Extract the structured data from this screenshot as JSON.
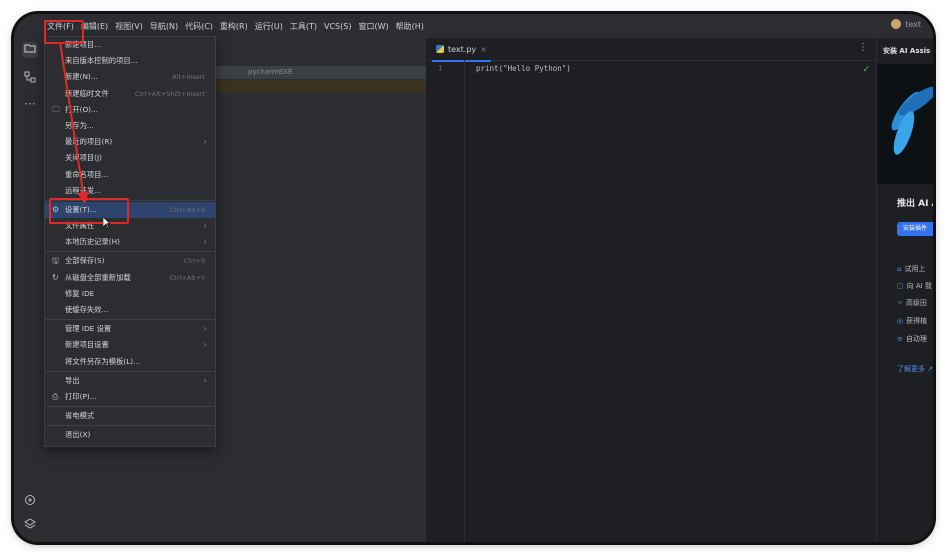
{
  "menubar": {
    "items": [
      "文件(F)",
      "编辑(E)",
      "视图(V)",
      "导航(N)",
      "代码(C)",
      "重构(R)",
      "运行(U)",
      "工具(T)",
      "VCS(S)",
      "窗口(W)",
      "帮助(H)"
    ],
    "account": "text"
  },
  "left_toolbar": {
    "icons": [
      "folder-icon",
      "structure-icon",
      "more-icon",
      "python-console-icon",
      "layers-icon"
    ]
  },
  "project_panel": {
    "row_text": "pycharmEXE"
  },
  "editor": {
    "tab_label": "text.py",
    "tab_close": "×",
    "line_number": "1",
    "code_line": "print(\"Hello Python\")",
    "menu_glyph": "⋮",
    "check_glyph": "✓"
  },
  "file_menu": {
    "items": [
      {
        "label": "新建项目...",
        "shortcut": "",
        "arrow": false,
        "icon": ""
      },
      {
        "label": "来自版本控制的项目...",
        "shortcut": "",
        "arrow": false,
        "icon": ""
      },
      {
        "label": "新建(N)...",
        "shortcut": "Alt+Insert",
        "arrow": false,
        "icon": ""
      },
      {
        "label": "新建临时文件",
        "shortcut": "Ctrl+Alt+Shift+Insert",
        "arrow": false,
        "icon": ""
      },
      {
        "label": "打开(O)...",
        "shortcut": "",
        "arrow": false,
        "icon": "🗀"
      },
      {
        "label": "另存为...",
        "shortcut": "",
        "arrow": false,
        "icon": ""
      },
      {
        "label": "最近的项目(R)",
        "shortcut": "",
        "arrow": true,
        "icon": ""
      },
      {
        "label": "关闭项目(J)",
        "shortcut": "",
        "arrow": false,
        "icon": ""
      },
      {
        "label": "重命名项目...",
        "shortcut": "",
        "arrow": false,
        "icon": ""
      },
      {
        "label": "远程开发...",
        "shortcut": "",
        "arrow": false,
        "icon": ""
      },
      {
        "sep": true
      },
      {
        "label": "设置(T)...",
        "shortcut": "Ctrl+Alt+S",
        "arrow": false,
        "icon": "⚙",
        "highlight": true
      },
      {
        "label": "文件属性",
        "shortcut": "",
        "arrow": true,
        "icon": ""
      },
      {
        "label": "本地历史记录(H)",
        "shortcut": "",
        "arrow": true,
        "icon": ""
      },
      {
        "sep": true
      },
      {
        "label": "全部保存(S)",
        "shortcut": "Ctrl+S",
        "arrow": false,
        "icon": "🖫"
      },
      {
        "label": "从磁盘全部重新加载",
        "shortcut": "Ctrl+Alt+Y",
        "arrow": false,
        "icon": "↻"
      },
      {
        "label": "修复 IDE",
        "shortcut": "",
        "arrow": false,
        "icon": ""
      },
      {
        "label": "使缓存失效...",
        "shortcut": "",
        "arrow": false,
        "icon": ""
      },
      {
        "sep": true
      },
      {
        "label": "管理 IDE 设置",
        "shortcut": "",
        "arrow": true,
        "icon": ""
      },
      {
        "label": "新建项目设置",
        "shortcut": "",
        "arrow": true,
        "icon": ""
      },
      {
        "label": "将文件另存为模板(L)...",
        "shortcut": "",
        "arrow": false,
        "icon": ""
      },
      {
        "sep": true
      },
      {
        "label": "导出",
        "shortcut": "",
        "arrow": true,
        "icon": ""
      },
      {
        "label": "打印(P)...",
        "shortcut": "",
        "arrow": false,
        "icon": "⎙"
      },
      {
        "sep": true
      },
      {
        "label": "省电模式",
        "shortcut": "",
        "arrow": false,
        "icon": ""
      },
      {
        "sep": true
      },
      {
        "label": "退出(X)",
        "shortcut": "",
        "arrow": false,
        "icon": ""
      }
    ]
  },
  "ai_panel": {
    "title": "安装 AI Assis",
    "heading": "推出 AI A",
    "install_button": "安装插件",
    "items": [
      {
        "icon": "⌂",
        "text": "试用上"
      },
      {
        "icon": "▢",
        "text": "向 AI 我"
      },
      {
        "icon": "✧",
        "text": "高级田"
      },
      {
        "icon": "◎",
        "text": "获得植"
      },
      {
        "icon": "≡",
        "text": "自动理"
      }
    ],
    "learn_more": "了解更多 ↗"
  },
  "colors": {
    "accent": "#3574f0",
    "annotation": "#e02a2a",
    "highlight": "#2e436e"
  }
}
